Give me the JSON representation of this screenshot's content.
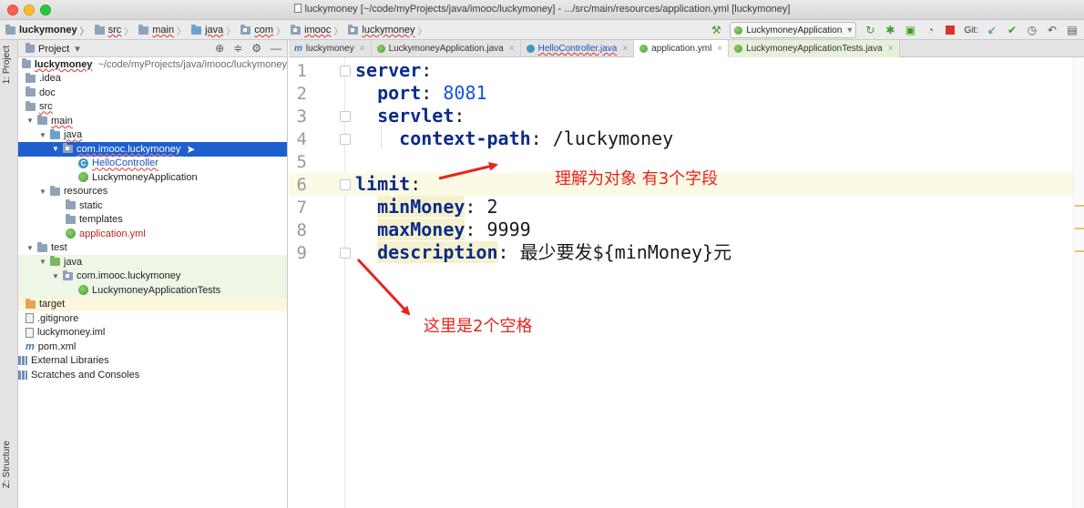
{
  "window": {
    "title": "luckymoney [~/code/myProjects/java/imooc/luckymoney] - .../src/main/resources/application.yml [luckymoney]"
  },
  "breadcrumbs": [
    "luckymoney",
    "src",
    "main",
    "java",
    "com",
    "imooc",
    "luckymoney"
  ],
  "toolbar": {
    "run_config": "LuckymoneyApplication",
    "git_label": "Git:"
  },
  "left_strip": {
    "project_tab": "1: Project",
    "structure_tab": "Z: Structure"
  },
  "project_panel": {
    "header": "Project",
    "tree": [
      {
        "label": "luckymoney",
        "suffix": "~/code/myProjects/java/imooc/luckymoney"
      },
      {
        "label": ".idea"
      },
      {
        "label": "doc"
      },
      {
        "label": "src"
      },
      {
        "label": "main"
      },
      {
        "label": "java"
      },
      {
        "label": "com.imooc.luckymoney"
      },
      {
        "label": "HelloController"
      },
      {
        "label": "LuckymoneyApplication"
      },
      {
        "label": "resources"
      },
      {
        "label": "static"
      },
      {
        "label": "templates"
      },
      {
        "label": "application.yml"
      },
      {
        "label": "test"
      },
      {
        "label": "java"
      },
      {
        "label": "com.imooc.luckymoney"
      },
      {
        "label": "LuckymoneyApplicationTests"
      },
      {
        "label": "target"
      },
      {
        "label": ".gitignore"
      },
      {
        "label": "luckymoney.iml"
      },
      {
        "label": "pom.xml"
      },
      {
        "label": "External Libraries"
      },
      {
        "label": "Scratches and Consoles"
      }
    ]
  },
  "tabs": [
    {
      "label": "luckymoney"
    },
    {
      "label": "LuckymoneyApplication.java"
    },
    {
      "label": "HelloController.java"
    },
    {
      "label": "application.yml"
    },
    {
      "label": "LuckymoneyApplicationTests.java"
    }
  ],
  "editor": {
    "lines": [
      {
        "n": "1",
        "indent": "",
        "key": "server",
        "sep": ":",
        "value": ""
      },
      {
        "n": "2",
        "indent": "  ",
        "key": "port",
        "sep": ": ",
        "value": "8081"
      },
      {
        "n": "3",
        "indent": "  ",
        "key": "servlet",
        "sep": ":",
        "value": ""
      },
      {
        "n": "4",
        "indent": "    ",
        "key": "context-path",
        "sep": ": ",
        "value": "/luckymoney"
      },
      {
        "n": "5",
        "indent": "",
        "key": "",
        "sep": "",
        "value": ""
      },
      {
        "n": "6",
        "indent": "",
        "key": "limit",
        "sep": ":",
        "value": ""
      },
      {
        "n": "7",
        "indent": "  ",
        "key": "minMoney",
        "sep": ": ",
        "value": "2"
      },
      {
        "n": "8",
        "indent": "  ",
        "key": "maxMoney",
        "sep": ": ",
        "value": "9999"
      },
      {
        "n": "9",
        "indent": "  ",
        "key": "description",
        "sep": ": ",
        "value": "最少要发${minMoney}元"
      }
    ]
  },
  "annotations": {
    "note1": "理解为对象  有3个字段",
    "note2": "这里是2个空格",
    "color": "#e8231f"
  }
}
